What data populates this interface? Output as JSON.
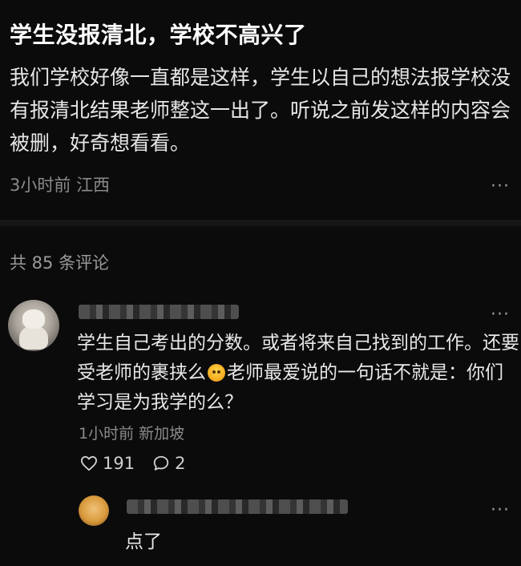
{
  "post": {
    "title": "学生没报清北，学校不高兴了",
    "body": "我们学校好像一直都是这样，学生以自己的想法报学校没有报清北结果老师整这一出了。听说之前发这样的内容会被删，好奇想看看。",
    "time": "3小时前",
    "location": "江西",
    "more_label": "···"
  },
  "comments_header": {
    "label": "共 85 条评论"
  },
  "comment": {
    "text_before_emoji": "学生自己考出的分数。或者将来自己找到的工作。还要受老师的裹挟么",
    "text_after_emoji": "老师最爱说的一句话不就是：你们学习是为我学的么？",
    "emoji_icon": "emoji-face-icon",
    "time": "1小时前",
    "location": "新加坡",
    "likes": "191",
    "replies": "2",
    "more_label": "···",
    "avatar_icon": "cat-avatar-icon"
  },
  "reply": {
    "text": "点了",
    "more_label": "···",
    "avatar_icon": "cartoon-avatar-icon"
  },
  "colors": {
    "background": "#0b0b0b",
    "text": "#e8e8e8",
    "muted": "#8a8a8a"
  }
}
